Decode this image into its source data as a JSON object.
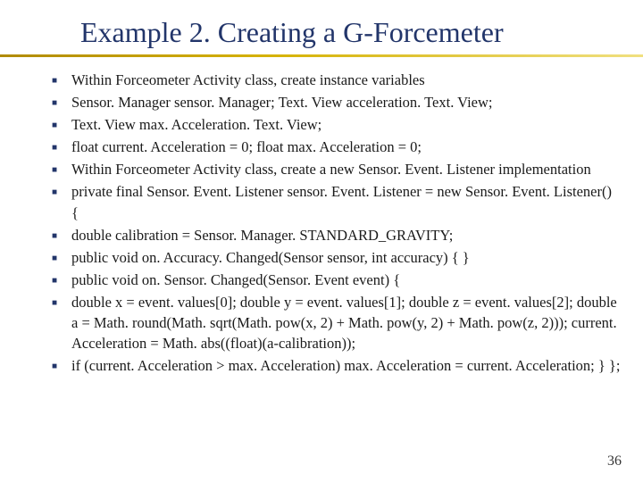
{
  "title": "Example 2. Creating a G-Forcemeter",
  "lines": [
    "Within Forceometer Activity class, create instance variables",
    "Sensor. Manager sensor. Manager;  Text. View acceleration. Text. View;",
    "Text. View max. Acceleration. Text. View;",
    "float current. Acceleration = 0;  float max. Acceleration = 0;",
    "Within Forceometer Activity class, create a new Sensor. Event. Listener implementation",
    "private final Sensor. Event. Listener sensor. Event. Listener = new Sensor. Event. Listener() {",
    "      double calibration = Sensor. Manager. STANDARD_GRAVITY;",
    "      public void on. Accuracy. Changed(Sensor sensor, int accuracy) { }",
    "      public void on. Sensor. Changed(Sensor. Event event) {",
    "            double x = event. values[0];   double y = event. values[1];   double z = event. values[2];    double a = Math. round(Math. sqrt(Math. pow(x, 2) + Math. pow(y, 2) + Math. pow(z, 2)));    current. Acceleration = Math. abs((float)(a-calibration));",
    "            if (current. Acceleration > max. Acceleration) max. Acceleration = current. Acceleration;     }    };"
  ],
  "pageNumber": "36"
}
